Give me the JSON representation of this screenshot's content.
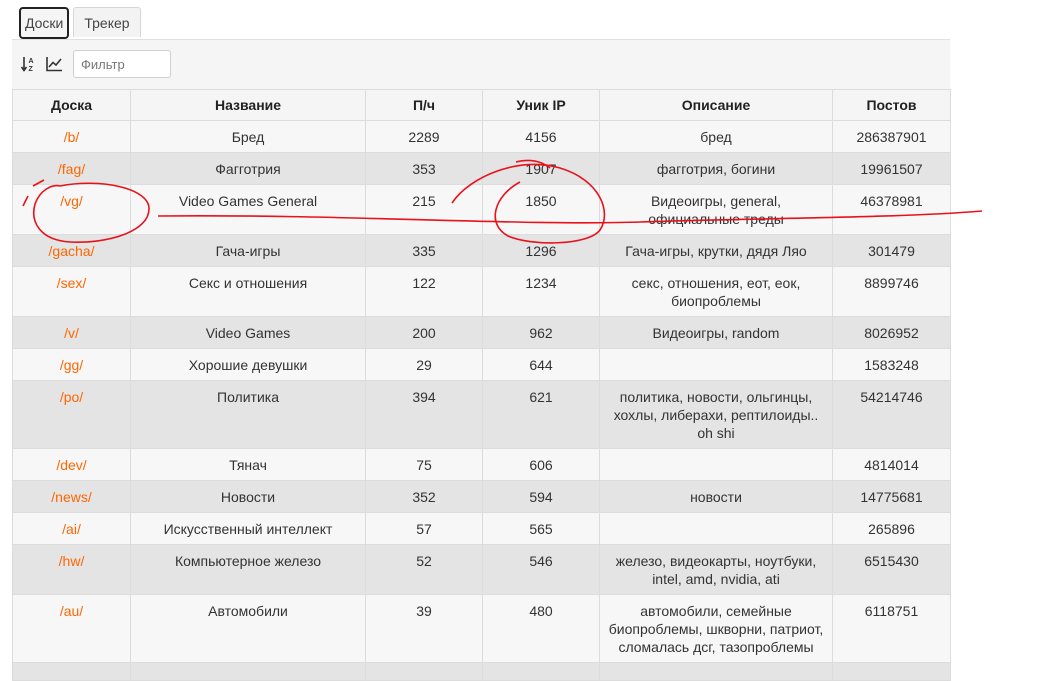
{
  "tabs": [
    {
      "label": "Доски",
      "active": true
    },
    {
      "label": "Трекер",
      "active": false
    }
  ],
  "toolbar": {
    "sort_icon": "sort-alpha-icon",
    "chart_icon": "line-chart-icon",
    "filter_placeholder": "Фильтр"
  },
  "table": {
    "headers": [
      "Доска",
      "Название",
      "П/ч",
      "Уник IP",
      "Описание",
      "Постов"
    ],
    "rows": [
      {
        "board": "/b/",
        "name": "Бред",
        "pph": "2289",
        "ips": "4156",
        "desc": "бред",
        "posts": "286387901"
      },
      {
        "board": "/fag/",
        "name": "Фагготрия",
        "pph": "353",
        "ips": "1907",
        "desc": "фагготрия, богини",
        "posts": "19961507"
      },
      {
        "board": "/vg/",
        "name": "Video Games General",
        "pph": "215",
        "ips": "1850",
        "desc": "Видеоигры, general, официальные треды",
        "posts": "46378981"
      },
      {
        "board": "/gacha/",
        "name": "Гача-игры",
        "pph": "335",
        "ips": "1296",
        "desc": "Гача-игры, крутки, дядя Ляо",
        "posts": "301479"
      },
      {
        "board": "/sex/",
        "name": "Секс и отношения",
        "pph": "122",
        "ips": "1234",
        "desc": "секс, отношения, еот, еок, биопроблемы",
        "posts": "8899746"
      },
      {
        "board": "/v/",
        "name": "Video Games",
        "pph": "200",
        "ips": "962",
        "desc": "Видеоигры, random",
        "posts": "8026952"
      },
      {
        "board": "/gg/",
        "name": "Хорошие девушки",
        "pph": "29",
        "ips": "644",
        "desc": "",
        "posts": "1583248"
      },
      {
        "board": "/po/",
        "name": "Политика",
        "pph": "394",
        "ips": "621",
        "desc": "политика, новости, ольгинцы, хохлы, либерахи, рептилоиды.. oh shi",
        "posts": "54214746"
      },
      {
        "board": "/dev/",
        "name": "Тянач",
        "pph": "75",
        "ips": "606",
        "desc": "",
        "posts": "4814014"
      },
      {
        "board": "/news/",
        "name": "Новости",
        "pph": "352",
        "ips": "594",
        "desc": "новости",
        "posts": "14775681"
      },
      {
        "board": "/ai/",
        "name": "Искусственный интеллект",
        "pph": "57",
        "ips": "565",
        "desc": "",
        "posts": "265896"
      },
      {
        "board": "/hw/",
        "name": "Компьютерное железо",
        "pph": "52",
        "ips": "546",
        "desc": "железо, видеокарты, ноутбуки, intel, amd, nvidia, ati",
        "posts": "6515430"
      },
      {
        "board": "/au/",
        "name": "Автомобили",
        "pph": "39",
        "ips": "480",
        "desc": "автомобили, семейные биопроблемы, шкворни, патриот, сломалась дсг, тазопроблемы",
        "posts": "6118751"
      },
      {
        "board": "",
        "name": "",
        "pph": "",
        "ips": "",
        "desc": "",
        "posts": ""
      }
    ]
  },
  "colors": {
    "board_link": "#ff6600",
    "annotation": "#e8121b",
    "row_odd": "#f7f7f7",
    "row_even": "#e4e4e4"
  }
}
